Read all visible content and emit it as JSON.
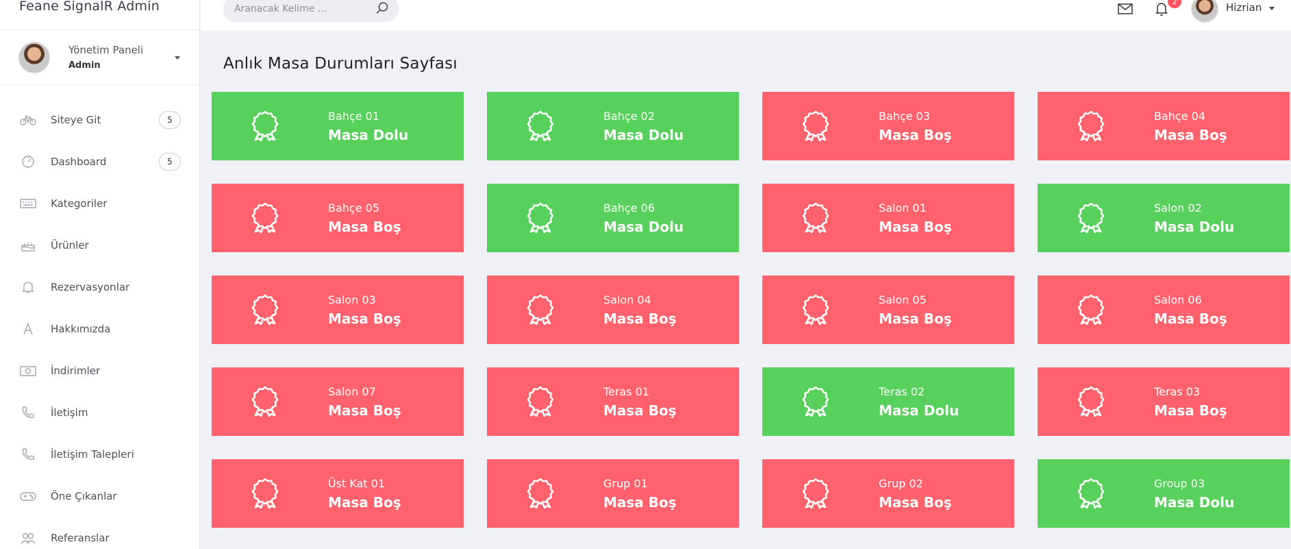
{
  "app": {
    "title": "Feane SignalR Admin"
  },
  "profile": {
    "name": "Yönetim Paneli",
    "role": "Admin"
  },
  "sidebar": {
    "items": [
      {
        "label": "Siteye Git",
        "icon": "bicycle-icon",
        "badge": "5"
      },
      {
        "label": "Dashboard",
        "icon": "speedometer-icon",
        "badge": "5"
      },
      {
        "label": "Kategoriler",
        "icon": "keyboard-icon"
      },
      {
        "label": "Ürünler",
        "icon": "cake-icon"
      },
      {
        "label": "Rezervasyonlar",
        "icon": "bell-icon"
      },
      {
        "label": "Hakkımızda",
        "icon": "letter-a-icon"
      },
      {
        "label": "İndirimler",
        "icon": "money-icon"
      },
      {
        "label": "İletişim",
        "icon": "phone-icon"
      },
      {
        "label": "İletişim Talepleri",
        "icon": "phone-icon"
      },
      {
        "label": "Öne Çıkanlar",
        "icon": "gamepad-icon"
      },
      {
        "label": "Referanslar",
        "icon": "users-icon"
      }
    ]
  },
  "topbar": {
    "search_placeholder": "Aranacak Kelime ...",
    "notification_count": "2",
    "user_name": "Hizrian"
  },
  "main": {
    "page_title": "Anlık Masa Durumları Sayfası",
    "tables": [
      {
        "name": "Bahçe 01",
        "status": "Masa Dolu",
        "state": "dolu"
      },
      {
        "name": "Bahçe 02",
        "status": "Masa Dolu",
        "state": "dolu"
      },
      {
        "name": "Bahçe 03",
        "status": "Masa Boş",
        "state": "bos"
      },
      {
        "name": "Bahçe 04",
        "status": "Masa Boş",
        "state": "bos"
      },
      {
        "name": "Bahçe 05",
        "status": "Masa Boş",
        "state": "bos"
      },
      {
        "name": "Bahçe 06",
        "status": "Masa Dolu",
        "state": "dolu"
      },
      {
        "name": "Salon 01",
        "status": "Masa Boş",
        "state": "bos"
      },
      {
        "name": "Salon 02",
        "status": "Masa Dolu",
        "state": "dolu"
      },
      {
        "name": "Salon 03",
        "status": "Masa Boş",
        "state": "bos"
      },
      {
        "name": "Salon 04",
        "status": "Masa Boş",
        "state": "bos"
      },
      {
        "name": "Salon 05",
        "status": "Masa Boş",
        "state": "bos"
      },
      {
        "name": "Salon 06",
        "status": "Masa Boş",
        "state": "bos"
      },
      {
        "name": "Salon 07",
        "status": "Masa Boş",
        "state": "bos"
      },
      {
        "name": "Teras 01",
        "status": "Masa Boş",
        "state": "bos"
      },
      {
        "name": "Teras 02",
        "status": "Masa Dolu",
        "state": "dolu"
      },
      {
        "name": "Teras 03",
        "status": "Masa Boş",
        "state": "bos"
      },
      {
        "name": "Üst Kat 01",
        "status": "Masa Boş",
        "state": "bos"
      },
      {
        "name": "Grup 01",
        "status": "Masa Boş",
        "state": "bos"
      },
      {
        "name": "Grup 02",
        "status": "Masa Boş",
        "state": "bos"
      },
      {
        "name": "Group 03",
        "status": "Masa Dolu",
        "state": "dolu"
      }
    ]
  },
  "colors": {
    "dolu": "#57d05c",
    "bos": "#ff626d",
    "card_icon": "award-icon"
  }
}
